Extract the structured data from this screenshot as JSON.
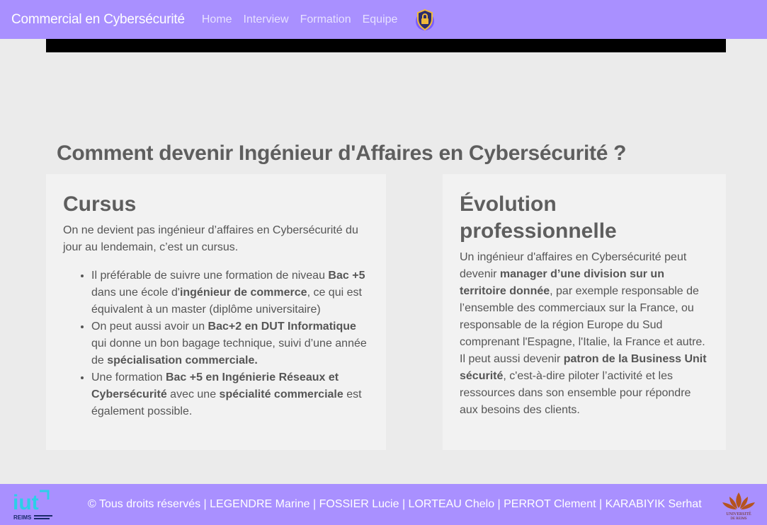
{
  "nav": {
    "brand": "Commercial en Cybersécurité",
    "links": [
      "Home",
      "Interview",
      "Formation",
      "Equipe"
    ],
    "logo_icon": "shield-lock-icon"
  },
  "main": {
    "title": "Comment devenir Ingénieur d'Affaires en Cybersécurité ?"
  },
  "cursus": {
    "heading": "Cursus",
    "intro": "On ne devient pas ingénieur d’affaires en Cybersécurité du jour au lendemain, c’est un cursus.",
    "items": [
      {
        "t1": "Il préférable de suivre une formation de niveau ",
        "b1": "Bac +5",
        "t2": " dans une école d'",
        "b2": "ingénieur de commerce",
        "t3": ", ce qui est équivalent à un master (diplôme universitaire)"
      },
      {
        "t1": "On peut aussi avoir un ",
        "b1": "Bac+2 en DUT Informatique",
        "t2": " qui donne un bon bagage technique, suivi d’une année de ",
        "b2": "spécialisation commerciale."
      },
      {
        "t1": "Une formation ",
        "b1": "Bac +5 en Ingénierie Réseaux et Cybersécurité",
        "t2": " avec une ",
        "b2": "spécialité commerciale",
        "t3": " est également possible."
      }
    ]
  },
  "evolution": {
    "heading": "Évolution professionnelle",
    "t1": "Un ingénieur d'affaires en Cybersécurité peut devenir ",
    "b1": "manager d’une division sur un territoire donnée",
    "t2": ", par exemple responsable de l’ensemble des commerciaux sur la France, ou responsable de la région Europe du Sud comprenant l'Espagne, l'Italie, la France et autre. Il peut aussi devenir ",
    "b2": "patron de la Business Unit sécurité",
    "t3": ", c'est-à-dire piloter l’activité et les ressources dans son ensemble pour répondre aux besoins des clients."
  },
  "footer": {
    "text": "© Tous droits réservés | LEGENDRE Marine | FOSSIER Lucie | LORTEAU Chelo | PERROT Clement | KARABIYIK Serhat",
    "iut_logo_text": "iut",
    "iut_logo_sub": "REIMS",
    "uni_logo_text": "UNIVERSITÉ DE REIMS"
  },
  "colors": {
    "nav_bg": "#a990ff",
    "page_bg": "#ebebeb",
    "card_bg": "#f2f2f2"
  }
}
